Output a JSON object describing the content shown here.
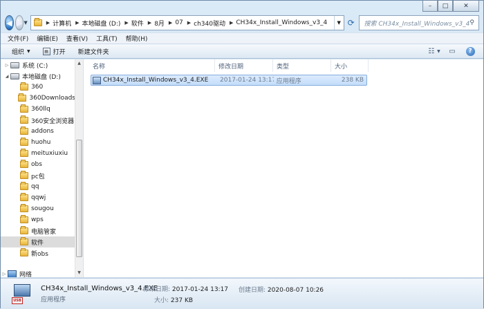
{
  "window": {
    "minimize_glyph": "–",
    "maximize_glyph": "□",
    "close_glyph": "✕"
  },
  "address": {
    "crumbs": [
      "计算机",
      "本地磁盘 (D:)",
      "软件",
      "8月",
      "07",
      "ch340驱动",
      "CH34x_Install_Windows_v3_4"
    ],
    "search_placeholder": "搜索 CH34x_Install_Windows_v3_4"
  },
  "menu": [
    "文件(F)",
    "编辑(E)",
    "查看(V)",
    "工具(T)",
    "帮助(H)"
  ],
  "toolbar": {
    "organize_label": "组织",
    "open_label": "打开",
    "new_folder_label": "新建文件夹",
    "help_glyph": "?"
  },
  "nav": {
    "items": [
      {
        "label": "系统 (C:)",
        "type": "drive",
        "top": 0
      },
      {
        "label": "本地磁盘 (D:)",
        "type": "drive"
      },
      {
        "label": "360",
        "type": "folder"
      },
      {
        "label": "360Downloads",
        "type": "folder"
      },
      {
        "label": "360llq",
        "type": "folder"
      },
      {
        "label": "360安全浏览器",
        "type": "folder"
      },
      {
        "label": "addons",
        "type": "folder"
      },
      {
        "label": "huohu",
        "type": "folder"
      },
      {
        "label": "meituxiuxiu",
        "type": "folder"
      },
      {
        "label": "obs",
        "type": "folder"
      },
      {
        "label": "pc包",
        "type": "folder"
      },
      {
        "label": "qq",
        "type": "folder"
      },
      {
        "label": "qqwj",
        "type": "folder"
      },
      {
        "label": "sougou",
        "type": "folder"
      },
      {
        "label": "wps",
        "type": "folder"
      },
      {
        "label": "电脑管家",
        "type": "folder"
      },
      {
        "label": "软件",
        "type": "folder",
        "selected": true
      },
      {
        "label": "新obs",
        "type": "folder"
      },
      {
        "label": "网络",
        "type": "network"
      }
    ]
  },
  "files": {
    "columns": [
      "名称",
      "修改日期",
      "类型",
      "大小"
    ],
    "rows": [
      {
        "name": "CH34x_Install_Windows_v3_4.EXE",
        "modified": "2017-01-24 13:17",
        "type": "应用程序",
        "size": "238 KB"
      }
    ]
  },
  "details": {
    "name": "CH34x_Install_Windows_v3_4.EXE",
    "type": "应用程序",
    "modified_label": "修改日期:",
    "modified_value": "2017-01-24 13:17",
    "size_label": "大小:",
    "size_value": "237 KB",
    "created_label": "创建日期:",
    "created_value": "2020-08-07 10:26",
    "icon_badge": "USB"
  }
}
